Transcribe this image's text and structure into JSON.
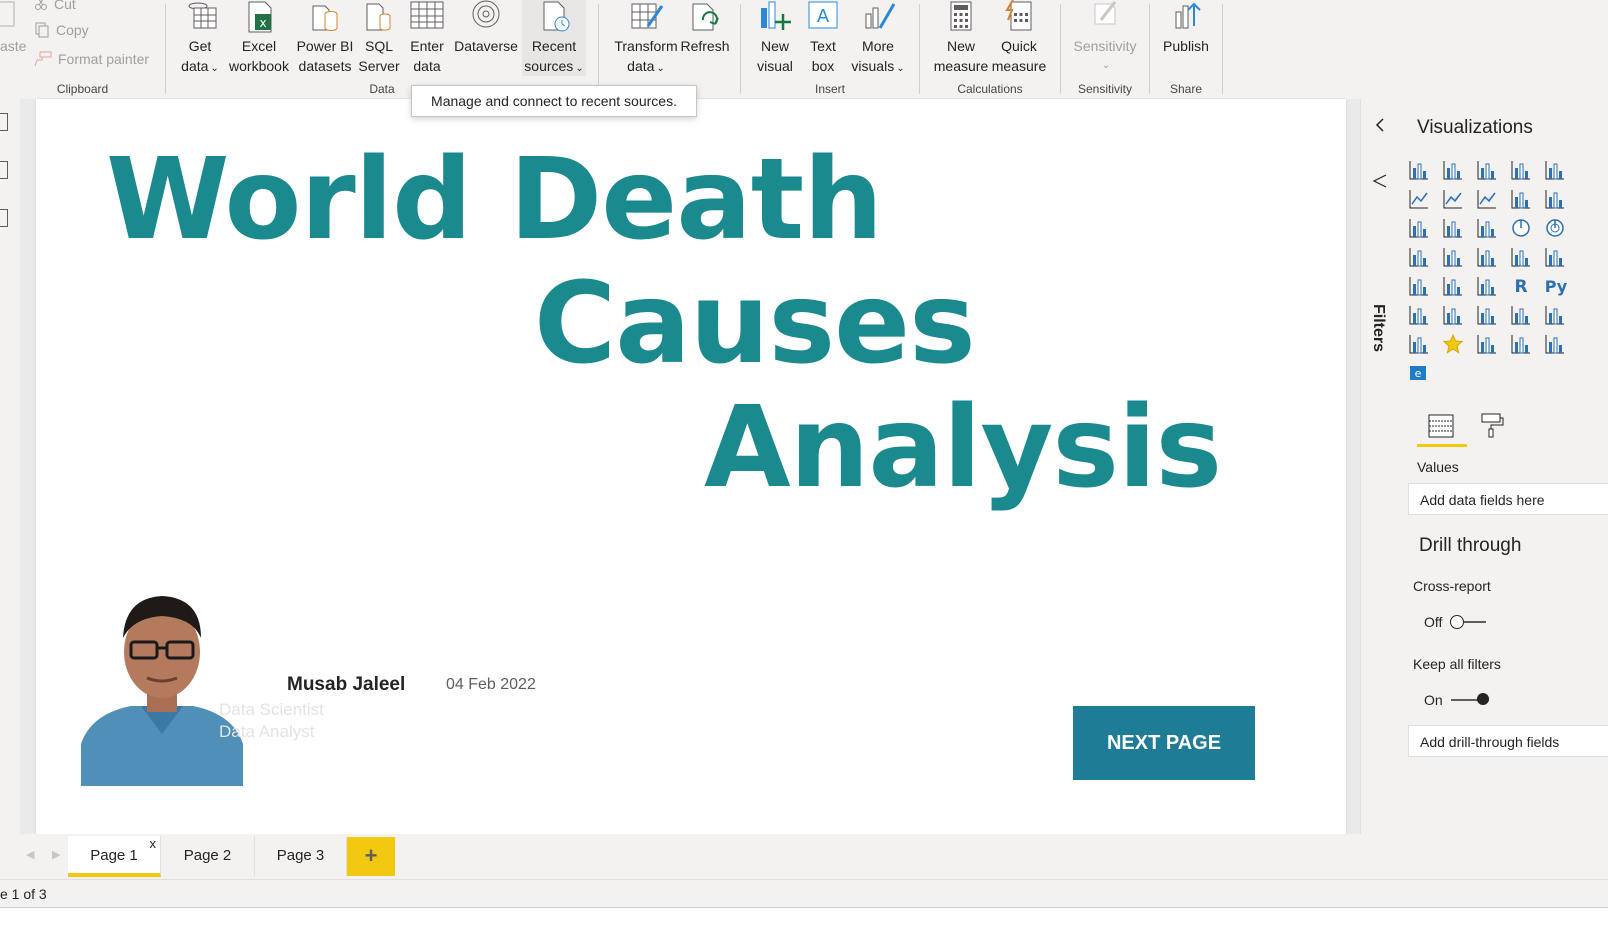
{
  "ribbon": {
    "clipboard": {
      "paste_label": "aste",
      "cut_label": "Cut",
      "copy_label": "Copy",
      "format_painter_label": "Format painter",
      "group_label": "Clipboard"
    },
    "data": {
      "get_data": [
        "Get",
        "data"
      ],
      "excel": [
        "Excel",
        "workbook"
      ],
      "powerbi": [
        "Power BI",
        "datasets"
      ],
      "sql": [
        "SQL",
        "Server"
      ],
      "enter": [
        "Enter",
        "data"
      ],
      "dataverse": "Dataverse",
      "recent": [
        "Recent",
        "sources"
      ],
      "group_label": "Data"
    },
    "queries": {
      "transform": [
        "Transform",
        "data"
      ],
      "refresh": "Refresh"
    },
    "insert": {
      "new_visual": [
        "New",
        "visual"
      ],
      "text_box": [
        "Text",
        "box"
      ],
      "more_visuals": [
        "More",
        "visuals"
      ],
      "group_label": "Insert"
    },
    "calculations": {
      "new_measure": [
        "New",
        "measure"
      ],
      "quick_measure": [
        "Quick",
        "measure"
      ],
      "group_label": "Calculations"
    },
    "sensitivity": {
      "label": "Sensitivity",
      "group_label": "Sensitivity"
    },
    "share": {
      "publish": "Publish",
      "group_label": "Share"
    },
    "tooltip": "Manage and connect to recent sources."
  },
  "report": {
    "title_lines": [
      "World Death",
      "Causes",
      "Analysis"
    ],
    "author": "Musab Jaleel",
    "date": "04 Feb 2022",
    "roles": [
      "Data Scientist",
      "Data Analyst"
    ],
    "next_button": "NEXT PAGE"
  },
  "filters": {
    "label": "Filters"
  },
  "visualizations": {
    "title": "Visualizations",
    "values_label": "Values",
    "values_placeholder": "Add data fields here",
    "drill_through_title": "Drill through",
    "cross_report_label": "Cross-report",
    "cross_report_state": "Off",
    "keep_filters_label": "Keep all filters",
    "keep_filters_state": "On",
    "drill_placeholder": "Add drill-through fields"
  },
  "pages": {
    "tabs": [
      "Page 1",
      "Page 2",
      "Page 3"
    ],
    "active": 0,
    "add_symbol": "+",
    "close_symbol": "x"
  },
  "status": {
    "text": "e 1 of 3"
  },
  "colors": {
    "title_teal": "#1b8a8f",
    "button_blue": "#1e7c96",
    "accent_yellow": "#f2c811",
    "ribbon_bg": "#f3f2f1"
  }
}
